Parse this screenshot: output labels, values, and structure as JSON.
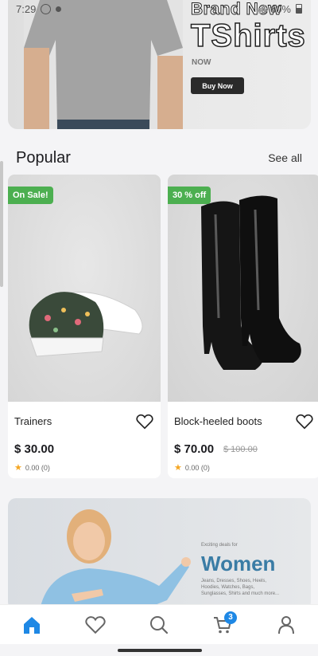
{
  "status_bar": {
    "time": "7:29",
    "battery": "60%"
  },
  "hero": {
    "title_line1": "Brand New",
    "title_line2": "TShirts",
    "subtitle": "NOW",
    "button_label": "Buy Now"
  },
  "section": {
    "title": "Popular",
    "see_all": "See all"
  },
  "products": [
    {
      "badge": "On Sale!",
      "name": "Trainers",
      "price": "$ 30.00",
      "old_price": "",
      "rating": "0.00 (0)"
    },
    {
      "badge": "30 % off",
      "name": "Block-heeled boots",
      "price": "$ 70.00",
      "old_price": "$ 100.00",
      "rating": "0.00 (0)"
    }
  ],
  "promo": {
    "small_text": "Exciting deals for",
    "headline": "Women",
    "description": "Jeans, Dresses, Shoes, Heels, Hoodies, Watches, Bags, Sunglasses, Shirts and much more..."
  },
  "bottom_nav": {
    "items": [
      "home-icon",
      "heart-icon",
      "search-icon",
      "cart-icon",
      "profile-icon"
    ],
    "cart_count": "3",
    "active_color": "#1e88e5",
    "inactive_color": "#666666"
  },
  "colors": {
    "badge_green": "#4caf50",
    "accent_blue": "#3a7ca5",
    "star": "#f5a623"
  }
}
